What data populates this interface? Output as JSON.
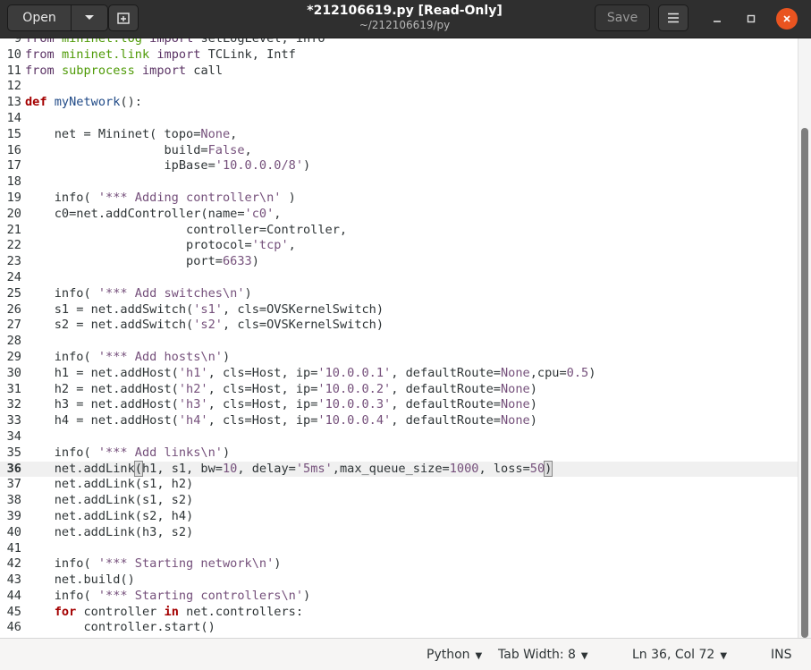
{
  "header": {
    "open_label": "Open",
    "title": "*212106619.py [Read-Only]",
    "subtitle": "~/212106619/py",
    "save_label": "Save",
    "icons": {
      "open_dropdown": "chevron-down-icon",
      "new_tab": "new-tab-icon",
      "menu": "hamburger-menu-icon",
      "minimize": "minimize-icon",
      "maximize": "maximize-icon",
      "close": "close-icon"
    },
    "accent_color": "#e95420"
  },
  "editor": {
    "current_line": 36,
    "lines": [
      {
        "n": 9,
        "html": "<span class=\"kw2\">from</span> <span class=\"mod\">mininet.log</span> <span class=\"kw2\">import</span> setLogLevel, info"
      },
      {
        "n": 10,
        "html": "<span class=\"kw2\">from</span> <span class=\"mod\">mininet.link</span> <span class=\"kw2\">import</span> TCLink, Intf"
      },
      {
        "n": 11,
        "html": "<span class=\"kw2\">from</span> <span class=\"mod\">subprocess</span> <span class=\"kw2\">import</span> call"
      },
      {
        "n": 12,
        "html": ""
      },
      {
        "n": 13,
        "html": "<span class=\"kw\">def</span> <span class=\"fn\">myNetwork</span>():"
      },
      {
        "n": 14,
        "html": ""
      },
      {
        "n": 15,
        "html": "    net = Mininet( topo=<span class=\"cst\">None</span>,"
      },
      {
        "n": 16,
        "html": "                   build=<span class=\"cst\">False</span>,"
      },
      {
        "n": 17,
        "html": "                   ipBase=<span class=\"str\">'10.0.0.0/8'</span>)"
      },
      {
        "n": 18,
        "html": ""
      },
      {
        "n": 19,
        "html": "    info( <span class=\"str\">'*** Adding controller\\n'</span> )"
      },
      {
        "n": 20,
        "html": "    c0=net.addController(name=<span class=\"str\">'c0'</span>,"
      },
      {
        "n": 21,
        "html": "                      controller=Controller,"
      },
      {
        "n": 22,
        "html": "                      protocol=<span class=\"str\">'tcp'</span>,"
      },
      {
        "n": 23,
        "html": "                      port=<span class=\"num\">6633</span>)"
      },
      {
        "n": 24,
        "html": ""
      },
      {
        "n": 25,
        "html": "    info( <span class=\"str\">'*** Add switches\\n'</span>)"
      },
      {
        "n": 26,
        "html": "    s1 = net.addSwitch(<span class=\"str\">'s1'</span>, cls=OVSKernelSwitch)"
      },
      {
        "n": 27,
        "html": "    s2 = net.addSwitch(<span class=\"str\">'s2'</span>, cls=OVSKernelSwitch)"
      },
      {
        "n": 28,
        "html": ""
      },
      {
        "n": 29,
        "html": "    info( <span class=\"str\">'*** Add hosts\\n'</span>)"
      },
      {
        "n": 30,
        "html": "    h1 = net.addHost(<span class=\"str\">'h1'</span>, cls=Host, ip=<span class=\"str\">'10.0.0.1'</span>, defaultRoute=<span class=\"cst\">None</span>,cpu=<span class=\"num\">0.5</span>)"
      },
      {
        "n": 31,
        "html": "    h2 = net.addHost(<span class=\"str\">'h2'</span>, cls=Host, ip=<span class=\"str\">'10.0.0.2'</span>, defaultRoute=<span class=\"cst\">None</span>)"
      },
      {
        "n": 32,
        "html": "    h3 = net.addHost(<span class=\"str\">'h3'</span>, cls=Host, ip=<span class=\"str\">'10.0.0.3'</span>, defaultRoute=<span class=\"cst\">None</span>)"
      },
      {
        "n": 33,
        "html": "    h4 = net.addHost(<span class=\"str\">'h4'</span>, cls=Host, ip=<span class=\"str\">'10.0.0.4'</span>, defaultRoute=<span class=\"cst\">None</span>)"
      },
      {
        "n": 34,
        "html": ""
      },
      {
        "n": 35,
        "html": "    info( <span class=\"str\">'*** Add links\\n'</span>)"
      },
      {
        "n": 36,
        "html": "    net.addLink<span class=\"cursor-mark\">(</span>h1, s1, bw=<span class=\"num\">10</span>, delay=<span class=\"str\">'5ms'</span>,max_queue_size=<span class=\"num\">1000</span>, loss=<span class=\"num\">50</span><span class=\"cursor-mark\">)</span>"
      },
      {
        "n": 37,
        "html": "    net.addLink(s1, h2)"
      },
      {
        "n": 38,
        "html": "    net.addLink(s1, s2)"
      },
      {
        "n": 39,
        "html": "    net.addLink(s2, h4)"
      },
      {
        "n": 40,
        "html": "    net.addLink(h3, s2)"
      },
      {
        "n": 41,
        "html": ""
      },
      {
        "n": 42,
        "html": "    info( <span class=\"str\">'*** Starting network\\n'</span>)"
      },
      {
        "n": 43,
        "html": "    net.build()"
      },
      {
        "n": 44,
        "html": "    info( <span class=\"str\">'*** Starting controllers\\n'</span>)"
      },
      {
        "n": 45,
        "html": "    <span class=\"kw\">for</span> controller <span class=\"kw\">in</span> net.controllers:"
      },
      {
        "n": 46,
        "html": "        controller.start()"
      }
    ]
  },
  "status": {
    "language": "Python",
    "tab_width": "Tab Width: 8",
    "position": "Ln 36, Col 72",
    "mode": "INS"
  }
}
